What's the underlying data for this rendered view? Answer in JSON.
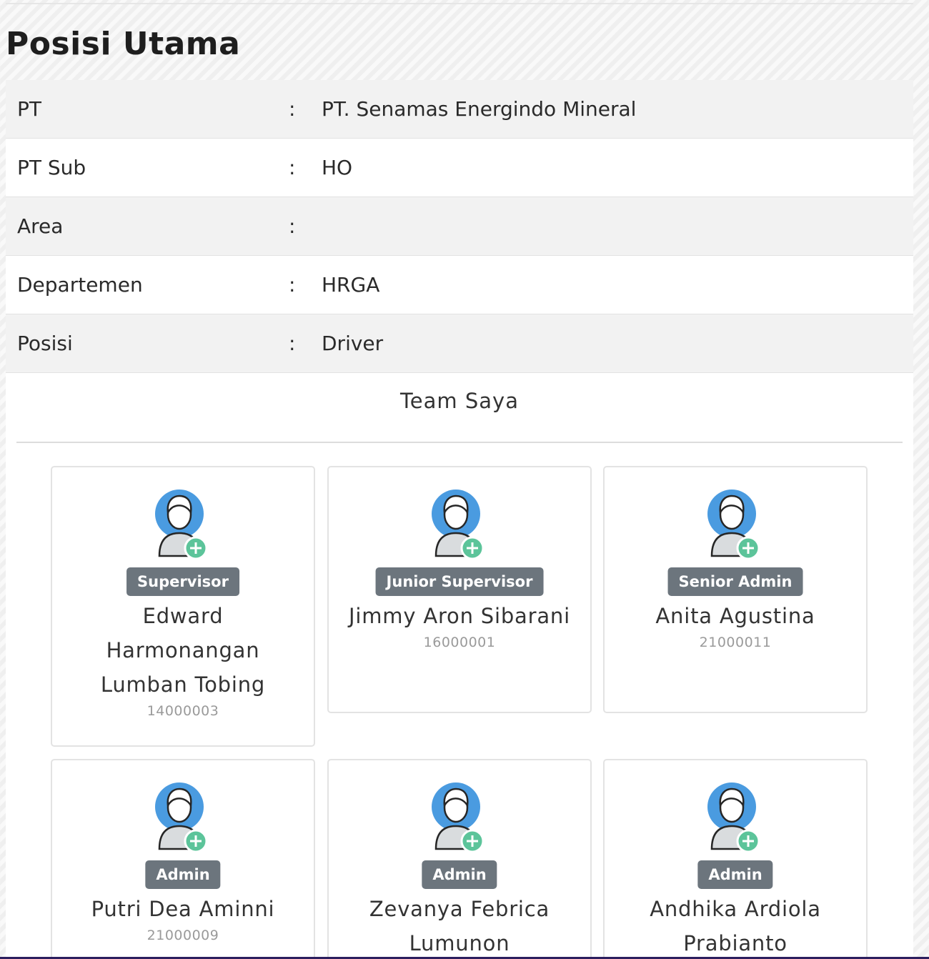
{
  "page_title": "Posisi Utama",
  "info": [
    {
      "label": "PT",
      "colon": ":",
      "value": "PT. Senamas Energindo Mineral"
    },
    {
      "label": "PT Sub",
      "colon": ":",
      "value": "HO"
    },
    {
      "label": "Area",
      "colon": ":",
      "value": ""
    },
    {
      "label": "Departemen",
      "colon": ":",
      "value": "HRGA"
    },
    {
      "label": "Posisi",
      "colon": ":",
      "value": "Driver"
    }
  ],
  "team": {
    "title": "Team Saya",
    "members": [
      {
        "role": "Supervisor",
        "name": "Edward Harmonangan Lumban Tobing",
        "id": "14000003",
        "avatar_icon": "user-add-avatar-icon"
      },
      {
        "role": "Junior Supervisor",
        "name": "Jimmy Aron Sibarani",
        "id": "16000001",
        "avatar_icon": "user-add-avatar-icon"
      },
      {
        "role": "Senior Admin",
        "name": "Anita Agustina",
        "id": "21000011",
        "avatar_icon": "user-add-avatar-icon"
      },
      {
        "role": "Admin",
        "name": "Putri Dea Aminni",
        "id": "21000009",
        "avatar_icon": "user-add-avatar-icon"
      },
      {
        "role": "Admin",
        "name": "Zevanya Febrica Lumunon",
        "id": "",
        "avatar_icon": "user-add-avatar-icon"
      },
      {
        "role": "Admin",
        "name": "Andhika Ardiola Prabianto",
        "id": "",
        "avatar_icon": "user-add-avatar-icon"
      }
    ]
  },
  "colors": {
    "avatar_circle": "#4a9be0",
    "plus_badge": "#5cc49a",
    "role_badge": "#6c757d"
  }
}
